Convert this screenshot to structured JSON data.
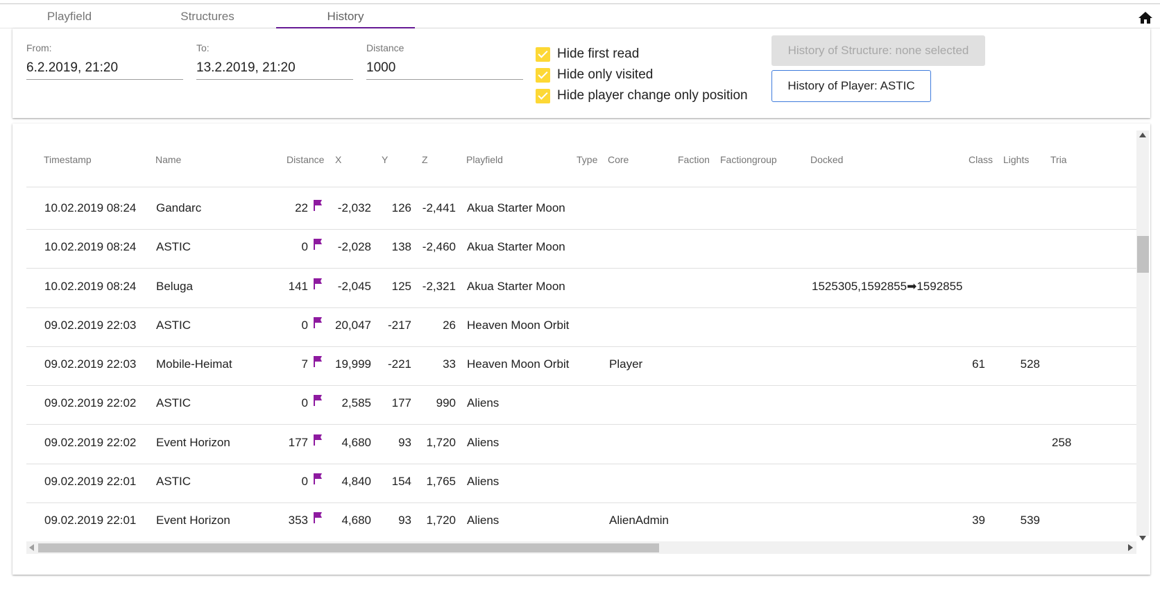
{
  "tabs": [
    {
      "label": "Playfield",
      "active": false
    },
    {
      "label": "Structures",
      "active": false
    },
    {
      "label": "History",
      "active": true
    }
  ],
  "icons": {
    "home": "home-icon",
    "flag": "flag-icon"
  },
  "colors": {
    "accent": "#6a1b9a",
    "checkbox": "#fdd835",
    "flag": "#8e1aa0",
    "button_border": "#3f7bdc"
  },
  "filters": {
    "from": {
      "label": "From:",
      "value": "6.2.2019, 21:20"
    },
    "to": {
      "label": "To:",
      "value": "13.2.2019, 21:20"
    },
    "distance": {
      "label": "Distance",
      "value": "1000"
    }
  },
  "checkboxes": [
    {
      "label": "Hide first read",
      "checked": true
    },
    {
      "label": "Hide only visited",
      "checked": true
    },
    {
      "label": "Hide player change only position",
      "checked": true
    }
  ],
  "buttons": {
    "structure_history": "History of Structure: none selected",
    "player_history": "History of Player: ASTIC"
  },
  "table": {
    "columns": [
      "Timestamp",
      "Name",
      "Distance",
      "X",
      "Y",
      "Z",
      "Playfield",
      "Type",
      "Core",
      "Faction",
      "Factiongroup",
      "Docked",
      "Class",
      "Lights",
      "Tria"
    ],
    "rows": [
      {
        "timestamp": "10.02.2019 08:24",
        "name": "Gandarc",
        "distance": "22",
        "x": "-2,032",
        "y": "126",
        "z": "-2,441",
        "playfield": "Akua Starter Moon",
        "core": "",
        "docked": "",
        "class": "",
        "lights": "",
        "tria": ""
      },
      {
        "timestamp": "10.02.2019 08:24",
        "name": "ASTIC",
        "distance": "0",
        "x": "-2,028",
        "y": "138",
        "z": "-2,460",
        "playfield": "Akua Starter Moon",
        "core": "",
        "docked": "",
        "class": "",
        "lights": "",
        "tria": ""
      },
      {
        "timestamp": "10.02.2019 08:24",
        "name": "Beluga",
        "distance": "141",
        "x": "-2,045",
        "y": "125",
        "z": "-2,321",
        "playfield": "Akua Starter Moon",
        "core": "",
        "docked": "1525305,1592855➡1592855",
        "class": "",
        "lights": "",
        "tria": ""
      },
      {
        "timestamp": "09.02.2019 22:03",
        "name": "ASTIC",
        "distance": "0",
        "x": "20,047",
        "y": "-217",
        "z": "26",
        "playfield": "Heaven Moon Orbit",
        "core": "",
        "docked": "",
        "class": "",
        "lights": "",
        "tria": ""
      },
      {
        "timestamp": "09.02.2019 22:03",
        "name": "Mobile-Heimat",
        "distance": "7",
        "x": "19,999",
        "y": "-221",
        "z": "33",
        "playfield": "Heaven Moon Orbit",
        "core": "Player",
        "docked": "",
        "class": "61",
        "lights": "528",
        "tria": ""
      },
      {
        "timestamp": "09.02.2019 22:02",
        "name": "ASTIC",
        "distance": "0",
        "x": "2,585",
        "y": "177",
        "z": "990",
        "playfield": "Aliens",
        "core": "",
        "docked": "",
        "class": "",
        "lights": "",
        "tria": ""
      },
      {
        "timestamp": "09.02.2019 22:02",
        "name": "Event Horizon",
        "distance": "177",
        "x": "4,680",
        "y": "93",
        "z": "1,720",
        "playfield": "Aliens",
        "core": "",
        "docked": "",
        "class": "",
        "lights": "",
        "tria": "258"
      },
      {
        "timestamp": "09.02.2019 22:01",
        "name": "ASTIC",
        "distance": "0",
        "x": "4,840",
        "y": "154",
        "z": "1,765",
        "playfield": "Aliens",
        "core": "",
        "docked": "",
        "class": "",
        "lights": "",
        "tria": ""
      },
      {
        "timestamp": "09.02.2019 22:01",
        "name": "Event Horizon",
        "distance": "353",
        "x": "4,680",
        "y": "93",
        "z": "1,720",
        "playfield": "Aliens",
        "core": "AlienAdmin",
        "docked": "",
        "class": "39",
        "lights": "539",
        "tria": ""
      }
    ]
  }
}
